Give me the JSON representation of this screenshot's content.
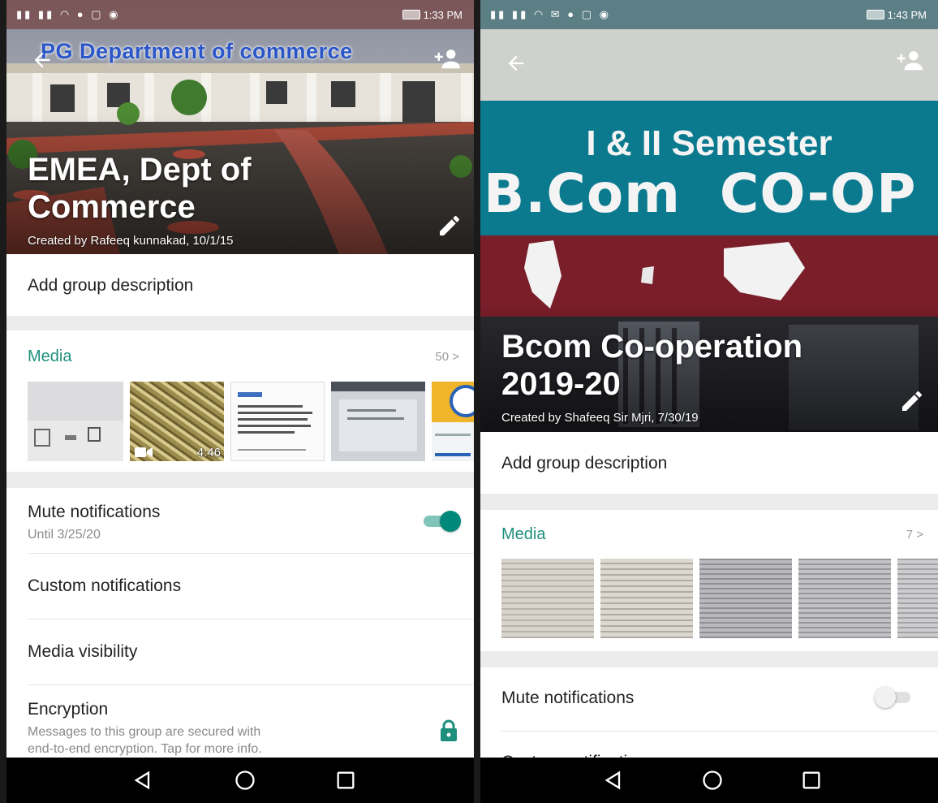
{
  "left": {
    "status_time": "1:33 PM",
    "banner_text": "PG Department of commerce",
    "group_name_line1": "EMEA, Dept of",
    "group_name_line2": "Commerce",
    "created_by": "Created by Rafeeq kunnakad, 10/1/15",
    "description_placeholder": "Add group description",
    "media_label": "Media",
    "media_count": "50 >",
    "video_duration": "4:46",
    "mute_title": "Mute notifications",
    "mute_sub": "Until 3/25/20",
    "mute_on": true,
    "custom_notifications": "Custom notifications",
    "media_visibility": "Media visibility",
    "encryption_title": "Encryption",
    "encryption_line1": "Messages to this group are secured with",
    "encryption_line2": "end-to-end encryption. Tap for more info."
  },
  "right": {
    "status_time": "1:43 PM",
    "sign_line1": "I & II Semester",
    "sign_line2": "B.Com  CO-OP",
    "group_name_line1": "Bcom Co-operation",
    "group_name_line2": "2019-20",
    "created_by": "Created by Shafeeq Sir Mjri, 7/30/19",
    "description_placeholder": "Add group description",
    "media_label": "Media",
    "media_count": "7 >",
    "mute_title": "Mute notifications",
    "mute_on": false,
    "custom_notifications_partial": "Custom notifications"
  },
  "icons": {
    "back": "arrow-left",
    "add_participant": "person-add",
    "edit": "pencil",
    "lock": "lock",
    "video": "camera",
    "nav_back": "triangle",
    "nav_home": "circle",
    "nav_recent": "square"
  },
  "colors": {
    "accent": "#1f8f7d",
    "toggle_on": "#00897b",
    "toggle_off": "#d6d6d6",
    "sign_teal": "#0b7a8f"
  }
}
